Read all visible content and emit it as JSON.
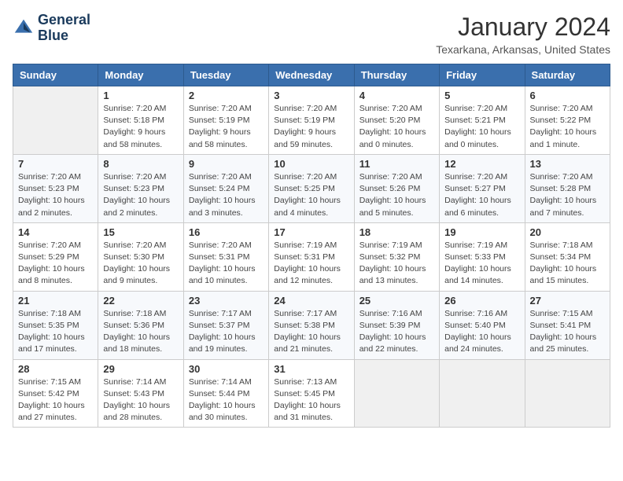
{
  "logo": {
    "line1": "General",
    "line2": "Blue"
  },
  "title": "January 2024",
  "location": "Texarkana, Arkansas, United States",
  "days_of_week": [
    "Sunday",
    "Monday",
    "Tuesday",
    "Wednesday",
    "Thursday",
    "Friday",
    "Saturday"
  ],
  "weeks": [
    [
      {
        "day": "",
        "sunrise": "",
        "sunset": "",
        "daylight": ""
      },
      {
        "day": "1",
        "sunrise": "Sunrise: 7:20 AM",
        "sunset": "Sunset: 5:18 PM",
        "daylight": "Daylight: 9 hours and 58 minutes."
      },
      {
        "day": "2",
        "sunrise": "Sunrise: 7:20 AM",
        "sunset": "Sunset: 5:19 PM",
        "daylight": "Daylight: 9 hours and 58 minutes."
      },
      {
        "day": "3",
        "sunrise": "Sunrise: 7:20 AM",
        "sunset": "Sunset: 5:19 PM",
        "daylight": "Daylight: 9 hours and 59 minutes."
      },
      {
        "day": "4",
        "sunrise": "Sunrise: 7:20 AM",
        "sunset": "Sunset: 5:20 PM",
        "daylight": "Daylight: 10 hours and 0 minutes."
      },
      {
        "day": "5",
        "sunrise": "Sunrise: 7:20 AM",
        "sunset": "Sunset: 5:21 PM",
        "daylight": "Daylight: 10 hours and 0 minutes."
      },
      {
        "day": "6",
        "sunrise": "Sunrise: 7:20 AM",
        "sunset": "Sunset: 5:22 PM",
        "daylight": "Daylight: 10 hours and 1 minute."
      }
    ],
    [
      {
        "day": "7",
        "sunrise": "Sunrise: 7:20 AM",
        "sunset": "Sunset: 5:23 PM",
        "daylight": "Daylight: 10 hours and 2 minutes."
      },
      {
        "day": "8",
        "sunrise": "Sunrise: 7:20 AM",
        "sunset": "Sunset: 5:23 PM",
        "daylight": "Daylight: 10 hours and 2 minutes."
      },
      {
        "day": "9",
        "sunrise": "Sunrise: 7:20 AM",
        "sunset": "Sunset: 5:24 PM",
        "daylight": "Daylight: 10 hours and 3 minutes."
      },
      {
        "day": "10",
        "sunrise": "Sunrise: 7:20 AM",
        "sunset": "Sunset: 5:25 PM",
        "daylight": "Daylight: 10 hours and 4 minutes."
      },
      {
        "day": "11",
        "sunrise": "Sunrise: 7:20 AM",
        "sunset": "Sunset: 5:26 PM",
        "daylight": "Daylight: 10 hours and 5 minutes."
      },
      {
        "day": "12",
        "sunrise": "Sunrise: 7:20 AM",
        "sunset": "Sunset: 5:27 PM",
        "daylight": "Daylight: 10 hours and 6 minutes."
      },
      {
        "day": "13",
        "sunrise": "Sunrise: 7:20 AM",
        "sunset": "Sunset: 5:28 PM",
        "daylight": "Daylight: 10 hours and 7 minutes."
      }
    ],
    [
      {
        "day": "14",
        "sunrise": "Sunrise: 7:20 AM",
        "sunset": "Sunset: 5:29 PM",
        "daylight": "Daylight: 10 hours and 8 minutes."
      },
      {
        "day": "15",
        "sunrise": "Sunrise: 7:20 AM",
        "sunset": "Sunset: 5:30 PM",
        "daylight": "Daylight: 10 hours and 9 minutes."
      },
      {
        "day": "16",
        "sunrise": "Sunrise: 7:20 AM",
        "sunset": "Sunset: 5:31 PM",
        "daylight": "Daylight: 10 hours and 10 minutes."
      },
      {
        "day": "17",
        "sunrise": "Sunrise: 7:19 AM",
        "sunset": "Sunset: 5:31 PM",
        "daylight": "Daylight: 10 hours and 12 minutes."
      },
      {
        "day": "18",
        "sunrise": "Sunrise: 7:19 AM",
        "sunset": "Sunset: 5:32 PM",
        "daylight": "Daylight: 10 hours and 13 minutes."
      },
      {
        "day": "19",
        "sunrise": "Sunrise: 7:19 AM",
        "sunset": "Sunset: 5:33 PM",
        "daylight": "Daylight: 10 hours and 14 minutes."
      },
      {
        "day": "20",
        "sunrise": "Sunrise: 7:18 AM",
        "sunset": "Sunset: 5:34 PM",
        "daylight": "Daylight: 10 hours and 15 minutes."
      }
    ],
    [
      {
        "day": "21",
        "sunrise": "Sunrise: 7:18 AM",
        "sunset": "Sunset: 5:35 PM",
        "daylight": "Daylight: 10 hours and 17 minutes."
      },
      {
        "day": "22",
        "sunrise": "Sunrise: 7:18 AM",
        "sunset": "Sunset: 5:36 PM",
        "daylight": "Daylight: 10 hours and 18 minutes."
      },
      {
        "day": "23",
        "sunrise": "Sunrise: 7:17 AM",
        "sunset": "Sunset: 5:37 PM",
        "daylight": "Daylight: 10 hours and 19 minutes."
      },
      {
        "day": "24",
        "sunrise": "Sunrise: 7:17 AM",
        "sunset": "Sunset: 5:38 PM",
        "daylight": "Daylight: 10 hours and 21 minutes."
      },
      {
        "day": "25",
        "sunrise": "Sunrise: 7:16 AM",
        "sunset": "Sunset: 5:39 PM",
        "daylight": "Daylight: 10 hours and 22 minutes."
      },
      {
        "day": "26",
        "sunrise": "Sunrise: 7:16 AM",
        "sunset": "Sunset: 5:40 PM",
        "daylight": "Daylight: 10 hours and 24 minutes."
      },
      {
        "day": "27",
        "sunrise": "Sunrise: 7:15 AM",
        "sunset": "Sunset: 5:41 PM",
        "daylight": "Daylight: 10 hours and 25 minutes."
      }
    ],
    [
      {
        "day": "28",
        "sunrise": "Sunrise: 7:15 AM",
        "sunset": "Sunset: 5:42 PM",
        "daylight": "Daylight: 10 hours and 27 minutes."
      },
      {
        "day": "29",
        "sunrise": "Sunrise: 7:14 AM",
        "sunset": "Sunset: 5:43 PM",
        "daylight": "Daylight: 10 hours and 28 minutes."
      },
      {
        "day": "30",
        "sunrise": "Sunrise: 7:14 AM",
        "sunset": "Sunset: 5:44 PM",
        "daylight": "Daylight: 10 hours and 30 minutes."
      },
      {
        "day": "31",
        "sunrise": "Sunrise: 7:13 AM",
        "sunset": "Sunset: 5:45 PM",
        "daylight": "Daylight: 10 hours and 31 minutes."
      },
      {
        "day": "",
        "sunrise": "",
        "sunset": "",
        "daylight": ""
      },
      {
        "day": "",
        "sunrise": "",
        "sunset": "",
        "daylight": ""
      },
      {
        "day": "",
        "sunrise": "",
        "sunset": "",
        "daylight": ""
      }
    ]
  ]
}
